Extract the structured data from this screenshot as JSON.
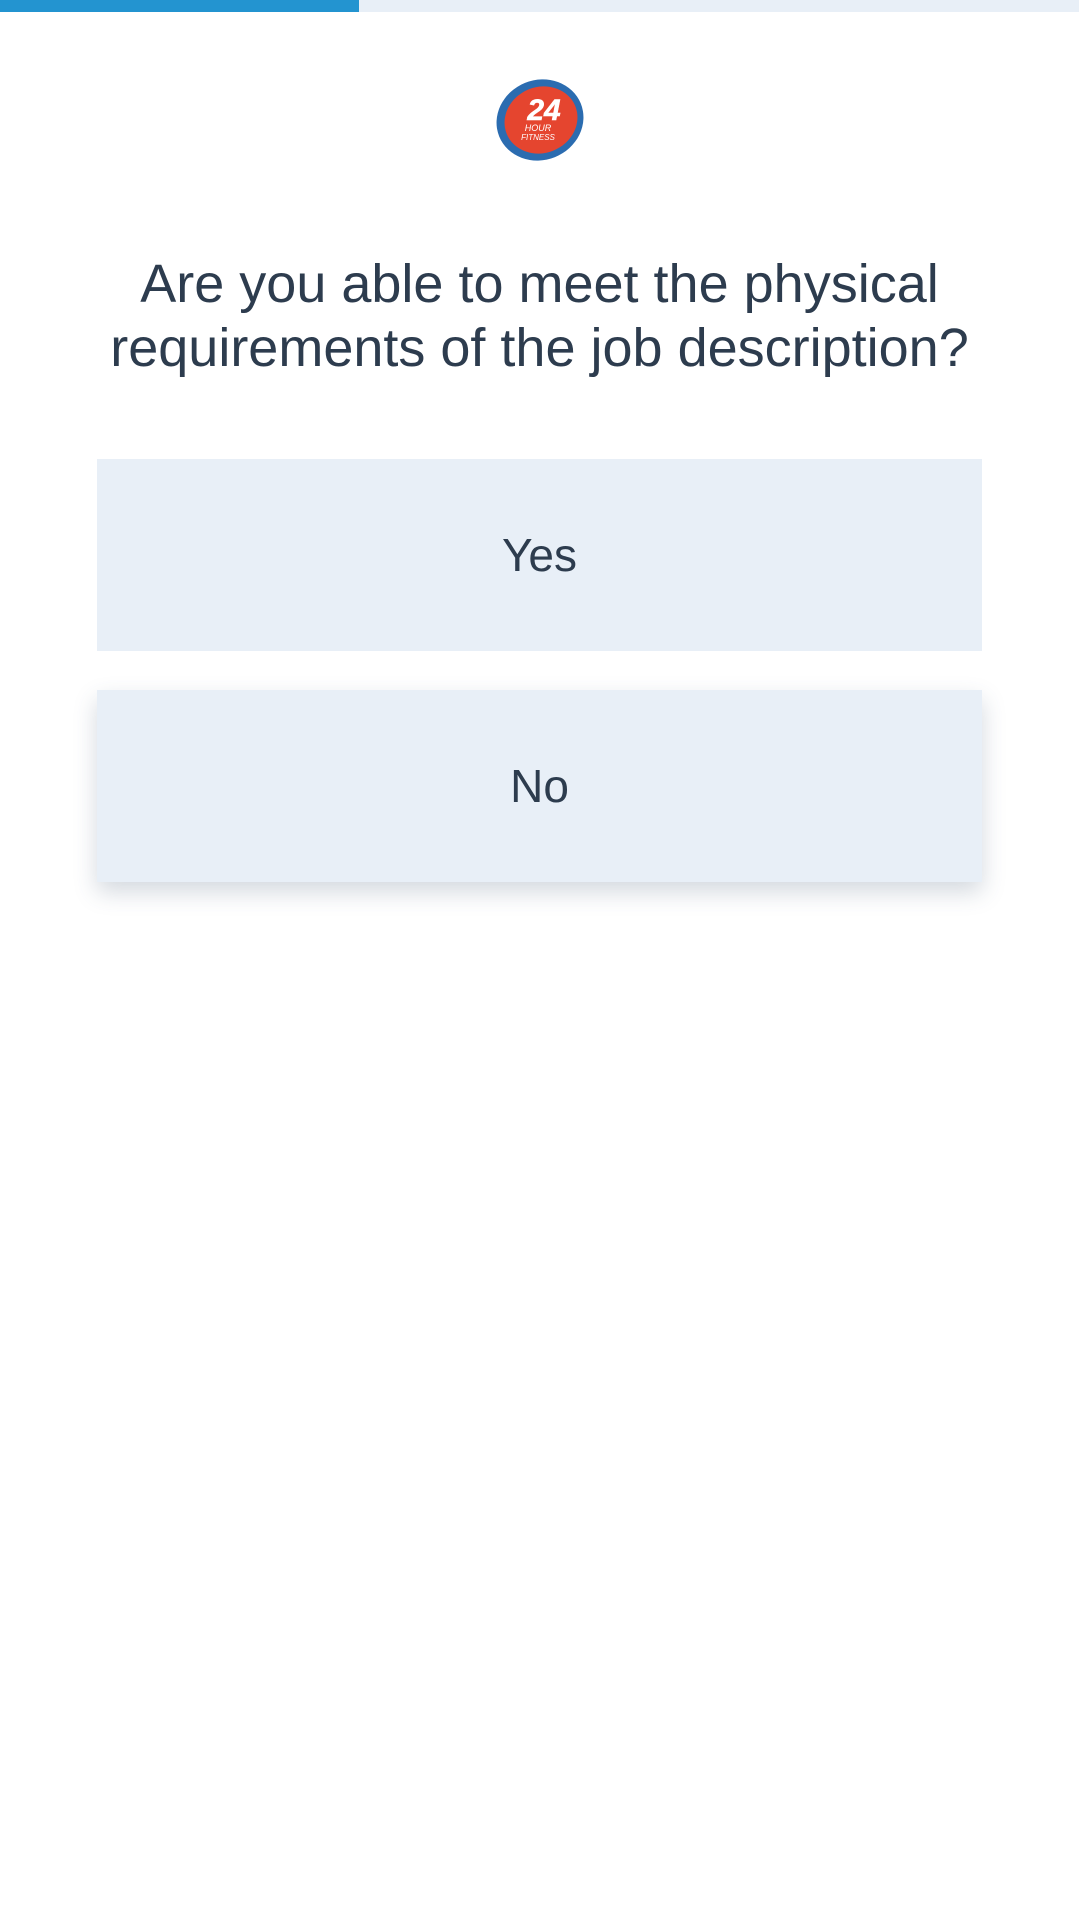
{
  "progress": {
    "fraction": 0.333
  },
  "logo": {
    "numeral": "24",
    "line1": "HOUR",
    "line2": "FITNESS",
    "colors": {
      "ring": "#2b6cb0",
      "fill": "#e5452f"
    }
  },
  "question": {
    "text": "Are you able to meet the physical requirements of the job description?"
  },
  "answers": [
    {
      "label": "Yes"
    },
    {
      "label": "No"
    }
  ],
  "colors": {
    "accent": "#2394d0",
    "track": "#e8eff7",
    "text": "#2d3c4e",
    "answer_bg": "#e8eff7"
  }
}
